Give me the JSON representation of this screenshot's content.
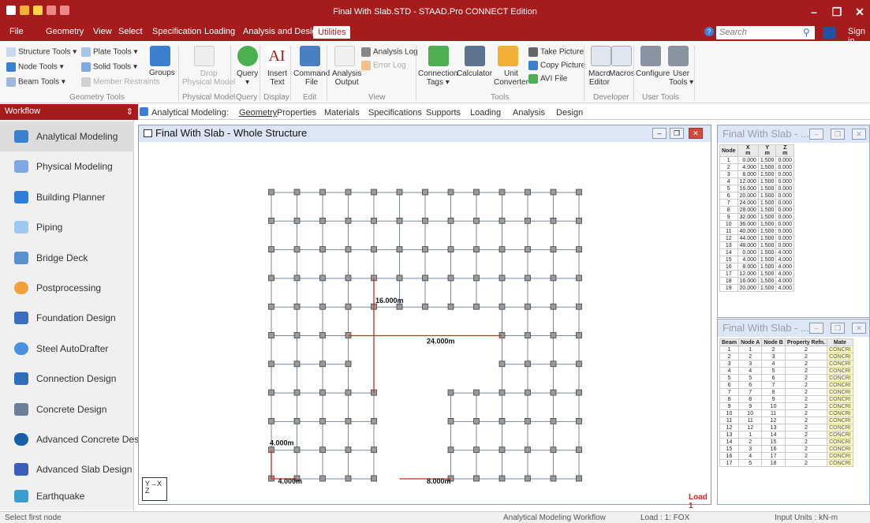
{
  "window": {
    "title": "Final With Slab.STD - STAAD.Pro CONNECT Edition",
    "minimize": "–",
    "restore": "❐",
    "close": "✕"
  },
  "menu": {
    "items": [
      "File",
      "Geometry",
      "View",
      "Select",
      "Specification",
      "Loading",
      "Analysis and Design",
      "Utilities"
    ],
    "active": "Utilities",
    "search_placeholder": "Search",
    "sign_in": "Sign in"
  },
  "ribbon": {
    "geometry_tools": {
      "structure": "Structure Tools ▾",
      "plate": "Plate Tools ▾",
      "node": "Node Tools ▾",
      "solid": "Solid Tools ▾",
      "beam": "Beam Tools ▾",
      "member_restraints": "Member Restraints",
      "groups": "Groups",
      "label": "Geometry Tools"
    },
    "physical_model": {
      "drop": "Drop\nPhysical Model",
      "label": "Physical Model"
    },
    "query": {
      "btn": "Query\n▾",
      "label": "Query"
    },
    "display": {
      "btn": "Insert\nText",
      "label": "Display"
    },
    "edit": {
      "btn": "Command\nFile",
      "label": "Edit"
    },
    "view": {
      "output": "Analysis\nOutput",
      "log": "Analysis Log",
      "error": "Error Log",
      "label": "View"
    },
    "tools": {
      "conn": "Connection\nTags ▾",
      "calc": "Calculator",
      "unit": "Unit\nConverter",
      "take": "Take Picture",
      "copy": "Copy Picture",
      "avi": "AVI File",
      "label": "Tools"
    },
    "developer": {
      "macro_editor": "Macro\nEditor",
      "macros": "Macros",
      "label": "Developer"
    },
    "user_tools": {
      "configure": "Configure",
      "user": "User\nTools ▾",
      "label": "User Tools"
    }
  },
  "workflow": {
    "header": "Workflow",
    "pin": "⇕",
    "items": [
      "Analytical Modeling",
      "Physical Modeling",
      "Building Planner",
      "Piping",
      "Bridge Deck",
      "Postprocessing",
      "Foundation Design",
      "Steel AutoDrafter",
      "Connection Design",
      "Concrete Design",
      "Advanced Concrete Desi...",
      "Advanced Slab Design",
      "Earthquake"
    ]
  },
  "tabs": {
    "prefix": "Analytical Modeling:",
    "items": [
      "Geometry",
      "Properties",
      "Materials",
      "Specifications",
      "Supports",
      "Loading",
      "Analysis",
      "Design"
    ],
    "active": "Geometry"
  },
  "viewport": {
    "title": "Final With Slab - Whole Structure",
    "load_label": "Load 1",
    "axis_label": "Y→X\nZ",
    "dims": [
      "16.000m",
      "24.000m",
      "4.000m",
      "4.000m",
      "8.000m"
    ]
  },
  "node_table": {
    "title": "Final With Slab - ...",
    "headers": [
      "Node",
      "X\nm",
      "Y\nm",
      "Z\nm"
    ],
    "rows": [
      [
        "1",
        "0.000",
        "1.500",
        "0.000"
      ],
      [
        "2",
        "4.000",
        "1.500",
        "0.000"
      ],
      [
        "3",
        "8.000",
        "1.500",
        "0.000"
      ],
      [
        "4",
        "12.000",
        "1.500",
        "0.000"
      ],
      [
        "5",
        "16.000",
        "1.500",
        "0.000"
      ],
      [
        "6",
        "20.000",
        "1.500",
        "0.000"
      ],
      [
        "7",
        "24.000",
        "1.500",
        "0.000"
      ],
      [
        "8",
        "28.000",
        "1.500",
        "0.000"
      ],
      [
        "9",
        "32.000",
        "1.500",
        "0.000"
      ],
      [
        "10",
        "36.000",
        "1.500",
        "0.000"
      ],
      [
        "11",
        "40.000",
        "1.500",
        "0.000"
      ],
      [
        "12",
        "44.000",
        "1.500",
        "0.000"
      ],
      [
        "13",
        "48.000",
        "1.500",
        "0.000"
      ],
      [
        "14",
        "0.000",
        "1.500",
        "4.000"
      ],
      [
        "15",
        "4.000",
        "1.500",
        "4.000"
      ],
      [
        "16",
        "8.000",
        "1.500",
        "4.000"
      ],
      [
        "17",
        "12.000",
        "1.500",
        "4.000"
      ],
      [
        "18",
        "16.000",
        "1.500",
        "4.000"
      ],
      [
        "19",
        "20.000",
        "1.500",
        "4.000"
      ]
    ]
  },
  "beam_table": {
    "title": "Final With Slab - ...",
    "headers": [
      "Beam",
      "Node A",
      "Node B",
      "Property Refn.",
      "Mate"
    ],
    "rows": [
      [
        "1",
        "1",
        "2",
        "2",
        "CONCRI"
      ],
      [
        "2",
        "2",
        "3",
        "2",
        "CONCRI"
      ],
      [
        "3",
        "3",
        "4",
        "2",
        "CONCRI"
      ],
      [
        "4",
        "4",
        "5",
        "2",
        "CONCRI"
      ],
      [
        "5",
        "5",
        "6",
        "2",
        "CONCRI"
      ],
      [
        "6",
        "6",
        "7",
        "2",
        "CONCRI"
      ],
      [
        "7",
        "7",
        "8",
        "2",
        "CONCRI"
      ],
      [
        "8",
        "8",
        "9",
        "2",
        "CONCRI"
      ],
      [
        "9",
        "9",
        "10",
        "2",
        "CONCRI"
      ],
      [
        "10",
        "10",
        "11",
        "2",
        "CONCRI"
      ],
      [
        "11",
        "11",
        "12",
        "2",
        "CONCRI"
      ],
      [
        "12",
        "12",
        "13",
        "2",
        "CONCRI"
      ],
      [
        "13",
        "1",
        "14",
        "2",
        "CONCRI"
      ],
      [
        "14",
        "2",
        "15",
        "2",
        "CONCRI"
      ],
      [
        "15",
        "3",
        "16",
        "2",
        "CONCRI"
      ],
      [
        "16",
        "4",
        "17",
        "2",
        "CONCRI"
      ],
      [
        "17",
        "5",
        "18",
        "2",
        "CONCRI"
      ]
    ]
  },
  "status": {
    "left": "Select first node",
    "workflow": "Analytical Modeling Workflow",
    "load": "Load : 1: FOX",
    "units": "Input Units : kN-m"
  },
  "colors": {
    "accent": "#a61c1c",
    "frame": "#7a8aa0",
    "dim": "#e02020"
  }
}
